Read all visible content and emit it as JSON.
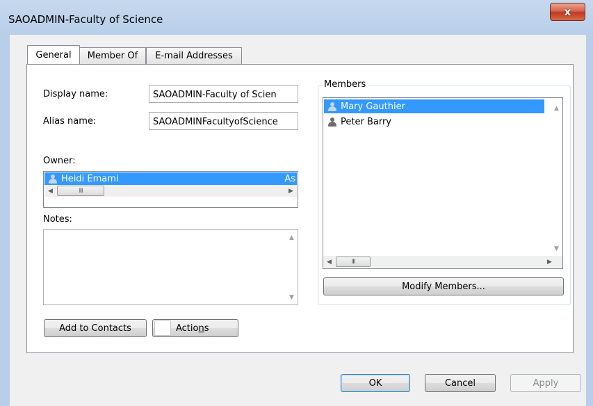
{
  "window": {
    "title": "SAOADMIN-Faculty of Science",
    "close_glyph": "x"
  },
  "tabs": [
    {
      "label": "General"
    },
    {
      "label": "Member Of"
    },
    {
      "label": "E-mail Addresses"
    }
  ],
  "general": {
    "display_name_label": "Display name:",
    "display_name_value": "SAOADMIN-Faculty of Scien",
    "alias_label": "Alias name:",
    "alias_value": "SAOADMINFacultyofScience",
    "owner_label": "Owner:",
    "owner": {
      "name": "Heidi Emami",
      "extra": "As"
    },
    "notes_label": "Notes:",
    "notes_value": "",
    "add_to_contacts_label": "Add to Contacts",
    "actions_label_prefix": "Actio",
    "actions_label_underlined": "n",
    "actions_label_suffix": "s"
  },
  "members": {
    "title": "Members",
    "items": [
      {
        "name": "Mary Gauthier",
        "selected": true
      },
      {
        "name": "Peter Barry",
        "selected": false
      }
    ],
    "modify_label": "Modify Members..."
  },
  "scroll": {
    "thumb_grip": "III",
    "left": "◀",
    "right": "▶",
    "up": "▲",
    "down": "▼"
  },
  "footer": {
    "ok_label": "OK",
    "cancel_label": "Cancel",
    "apply_label": "Apply"
  },
  "icons": {
    "person": "person-icon"
  }
}
